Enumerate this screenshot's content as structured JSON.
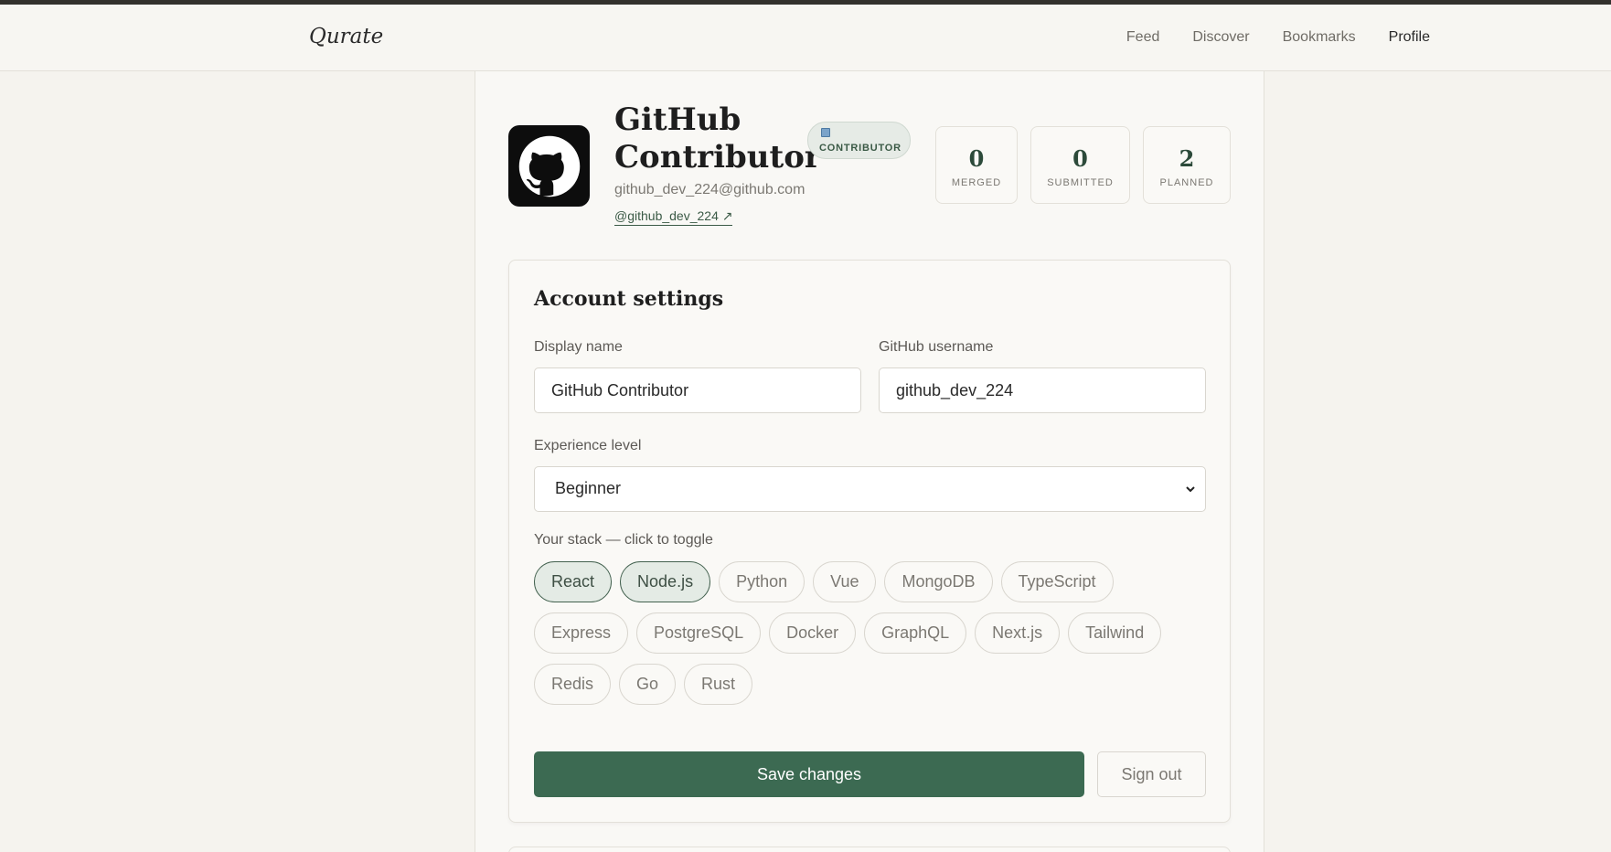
{
  "header": {
    "logo": "Qurate",
    "nav": [
      "Feed",
      "Discover",
      "Bookmarks",
      "Profile"
    ],
    "active_nav": "Profile"
  },
  "profile": {
    "name": "GitHub Contributor",
    "badge": "CONTRIBUTOR",
    "email": "github_dev_224@github.com",
    "handle": "@github_dev_224 ↗",
    "avatar_icon": "github-icon"
  },
  "stats": [
    {
      "value": "0",
      "label": "MERGED"
    },
    {
      "value": "0",
      "label": "SUBMITTED"
    },
    {
      "value": "2",
      "label": "PLANNED"
    }
  ],
  "settings": {
    "title": "Account settings",
    "display_name_label": "Display name",
    "display_name_value": "GitHub Contributor",
    "github_username_label": "GitHub username",
    "github_username_value": "github_dev_224",
    "experience_label": "Experience level",
    "experience_value": "Beginner",
    "stack_label": "Your stack — click to toggle",
    "stack": [
      {
        "name": "React",
        "selected": true
      },
      {
        "name": "Node.js",
        "selected": true
      },
      {
        "name": "Python",
        "selected": false
      },
      {
        "name": "Vue",
        "selected": false
      },
      {
        "name": "MongoDB",
        "selected": false
      },
      {
        "name": "TypeScript",
        "selected": false
      },
      {
        "name": "Express",
        "selected": false
      },
      {
        "name": "PostgreSQL",
        "selected": false
      },
      {
        "name": "Docker",
        "selected": false
      },
      {
        "name": "GraphQL",
        "selected": false
      },
      {
        "name": "Next.js",
        "selected": false
      },
      {
        "name": "Tailwind",
        "selected": false
      },
      {
        "name": "Redis",
        "selected": false
      },
      {
        "name": "Go",
        "selected": false
      },
      {
        "name": "Rust",
        "selected": false
      }
    ],
    "save_label": "Save changes",
    "signout_label": "Sign out"
  },
  "colors": {
    "accent": "#3c6a52",
    "background": "#f5f3ee",
    "chip_selected_bg": "#e4ebe5"
  }
}
